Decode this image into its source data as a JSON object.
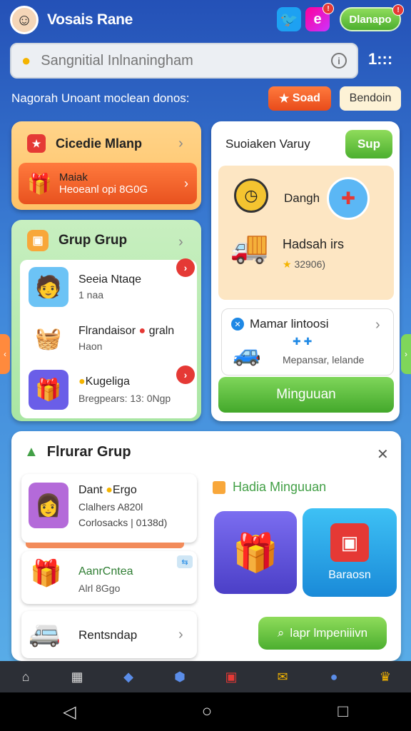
{
  "header": {
    "title": "Vosais Rane",
    "social_badge": "!",
    "action_label": "Dlanapo",
    "action_badge": "!"
  },
  "search": {
    "placeholder": "Sangnitial Inlnaningham",
    "more_label": "1:::"
  },
  "subheader": {
    "text": "Nagorah Unoant moclean donos:",
    "btn_primary": "Soad",
    "btn_secondary": "Bendoin"
  },
  "card_orange": {
    "title": "Cicedie Mlanp",
    "promo_line1": "Maiak",
    "promo_line2": "Heoeanl opi 8G0G"
  },
  "card_green": {
    "title": "Grup Grup",
    "items": [
      {
        "title": "Seeia Ntaqe",
        "sub": "1 naa"
      },
      {
        "title": "Flrandaisor",
        "tag": "graln",
        "sub": "Haon"
      },
      {
        "title": "Kugeliga",
        "sub": "Bregpears: 13: 0Ngp"
      }
    ]
  },
  "card_white": {
    "title": "Suoiaken Varuy",
    "button": "Sup",
    "row1": "Dangh",
    "row2_title": "Hadsah irs",
    "row2_sub": "32906)",
    "notice_title": "Mamar lintoosi",
    "notice_sub": "Mepansar, lelande",
    "main_button": "Minguuan"
  },
  "bottom_card": {
    "title": "Flrurar Grup",
    "items": [
      {
        "title": "Dant",
        "tag": "Ergo",
        "line2": "Clalhers A820l",
        "line3": "Corlosacks | 0138d)"
      },
      {
        "title": "AanrCntea",
        "line2": "Alrl 8Ggo"
      },
      {
        "title": "Rentsndap"
      }
    ],
    "section_title": "Hadia Minguuan",
    "tile_label": "Baraosn",
    "search_button": "lapr lmpeniiivn"
  },
  "icons": [
    "home-icon",
    "store-icon",
    "shop-icon",
    "shield-icon",
    "gift-icon",
    "mail-icon",
    "people-icon",
    "trophy-icon"
  ]
}
